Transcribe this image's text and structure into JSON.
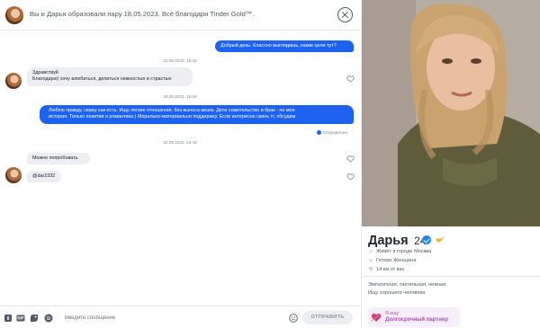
{
  "header": {
    "text": "Вы и Дарья образовали пару 18.05.2023. Всё благодаря Tinder Gold™."
  },
  "messages": [
    {
      "kind": "out",
      "text": "Добрый день. Классно выглядишь, какие цели тут?"
    },
    {
      "kind": "timestamp",
      "text": "18.05.2023, 19:40"
    },
    {
      "kind": "in",
      "lines": [
        "Здравствуй",
        "Благодарю) хочу влюбиться, делиться нежностью и страстью"
      ]
    },
    {
      "kind": "timestamp",
      "text": "29.05.2023, 15:49"
    },
    {
      "kind": "out",
      "lines": [
        "Люблю правду, скажу как есть. Ищу легкие отношения, без выноса мозга. Дети сожительство и брак - не моя",
        "история. Только позитив и романтика ) Морально-материально поддержку. Если интересно скинь тг, обсудим"
      ]
    },
    {
      "kind": "status",
      "text": "Отправлено"
    },
    {
      "kind": "timestamp",
      "text": "02.05.2023, 02:43"
    },
    {
      "kind": "in",
      "text": "Можно попробовать"
    },
    {
      "kind": "in",
      "text": "@dar2332"
    }
  ],
  "composer": {
    "placeholder": "Введите сообщение",
    "send_label": "ОТПРАВИТЬ",
    "icons": [
      "sticker-icon",
      "gif-icon",
      "bitmoji-icon",
      "spotify-icon",
      "emoji-icon"
    ]
  },
  "profile": {
    "name": "Дарья",
    "age": "24",
    "details": [
      {
        "icon": "home-icon",
        "text": "Живёт в городе Москва"
      },
      {
        "icon": "person-icon",
        "text": "Гетеро Женщина"
      },
      {
        "icon": "location-icon",
        "text": "14 км от вас"
      }
    ],
    "bio": [
      "Эмпатичная, тактильная, нежная",
      "Ищу хорошего человека"
    ],
    "looking_for": {
      "label": "Я ищу",
      "value": "Долгосрочный партнер"
    }
  },
  "colors": {
    "accent": "#1d62f0",
    "verified": "#1786ff",
    "looking": "#b24cbc"
  }
}
